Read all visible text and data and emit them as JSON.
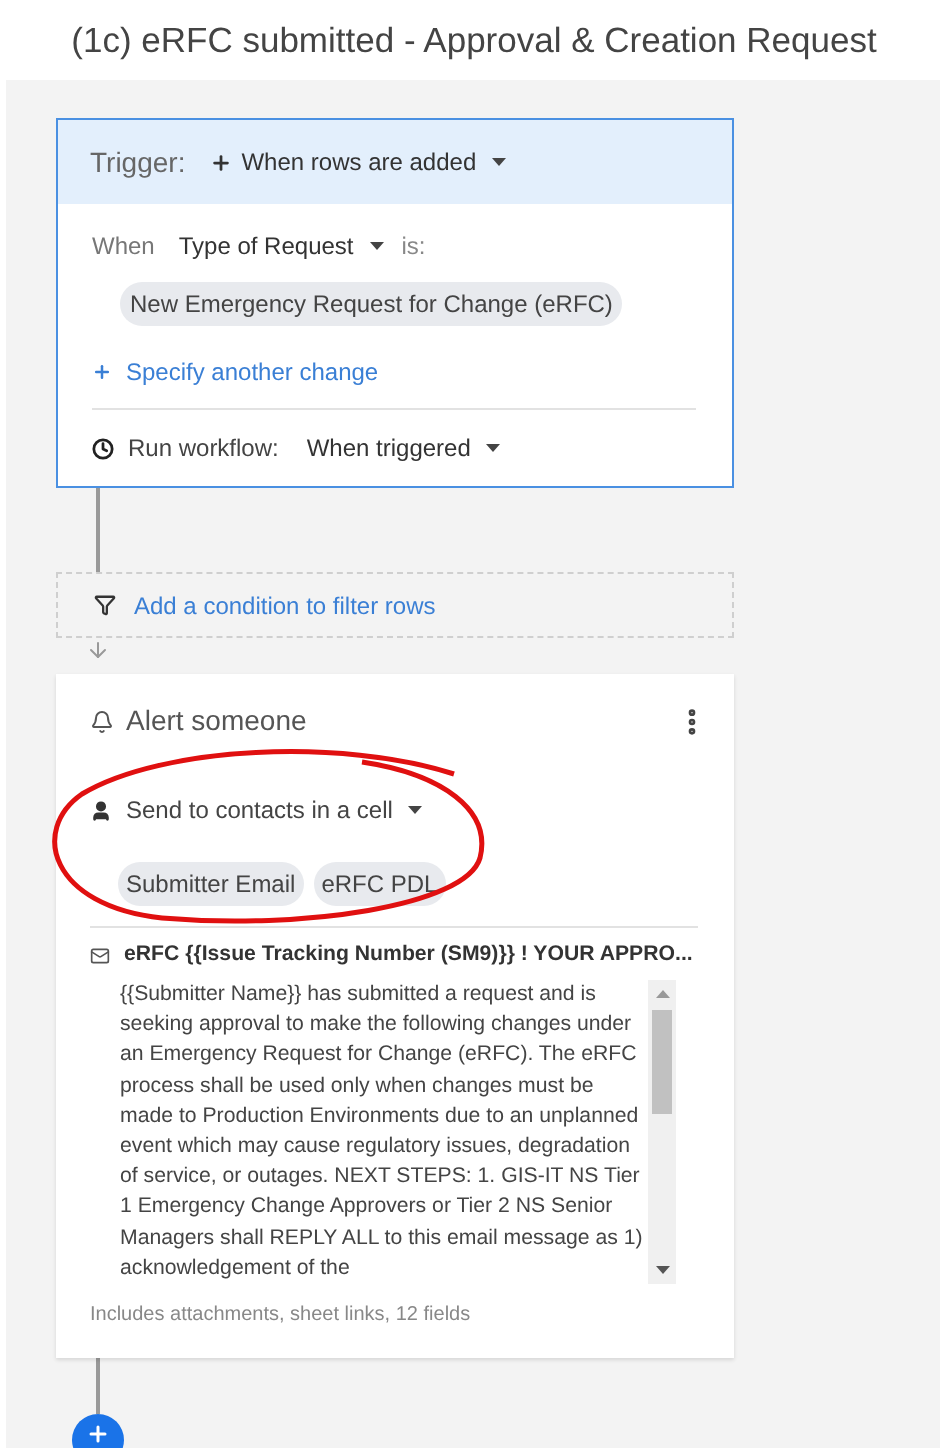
{
  "window": {
    "title": "(1c) eRFC submitted - Approval & Creation Request"
  },
  "trigger": {
    "label": "Trigger:",
    "event": "When rows are added",
    "when_label": "When",
    "field": "Type of Request",
    "operator": "is:",
    "values": [
      "New Emergency Request for Change (eRFC)"
    ],
    "add_link": "Specify another change",
    "run_label": "Run workflow:",
    "run_value": "When triggered"
  },
  "filter": {
    "link": "Add a condition to filter rows"
  },
  "action": {
    "title": "Alert someone",
    "recipients_mode": "Send to contacts in a cell",
    "recipients": [
      "Submitter Email",
      "eRFC PDL"
    ],
    "subject": "eRFC {{Issue Tracking Number (SM9)}} ! YOUR APPRO...",
    "body": "{{Submitter Name}} has submitted a request and is seeking approval to make the following changes under an Emergency Request for Change (eRFC). The eRFC process shall be used only when changes must be made to Production Environments due to an unplanned event which may cause regulatory issues, degradation of service, or outages. NEXT STEPS: 1. GIS-IT NS Tier 1 Emergency Change Approvers or Tier 2 NS Senior Managers shall REPLY ALL to this email message as 1) acknowledgement of the",
    "footer": "Includes attachments, sheet links, 12 fields"
  }
}
